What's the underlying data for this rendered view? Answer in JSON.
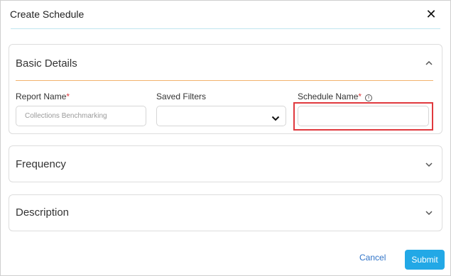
{
  "dialog": {
    "title": "Create Schedule",
    "close_icon": "close-icon"
  },
  "sections": {
    "basic": {
      "title": "Basic Details",
      "icon": "chevron-up-icon",
      "fields": {
        "report_name": {
          "label": "Report Name",
          "required": "*",
          "value": "Collections Benchmarking"
        },
        "saved_filters": {
          "label": "Saved Filters",
          "value": "",
          "icon": "chevron-down-icon"
        },
        "schedule_name": {
          "label": "Schedule Name",
          "required": "*",
          "value": "",
          "icon": "info-icon"
        }
      }
    },
    "frequency": {
      "title": "Frequency",
      "icon": "chevron-down-icon"
    },
    "description": {
      "title": "Description",
      "icon": "chevron-down-icon"
    }
  },
  "footer": {
    "cancel_label": "Cancel",
    "submit_label": "Submit"
  },
  "colors": {
    "accent_rule": "#f2b36d",
    "header_rule": "#bfe6ef",
    "required": "#e0393e",
    "submit_bg": "#22a8e6",
    "link": "#3174c8"
  }
}
